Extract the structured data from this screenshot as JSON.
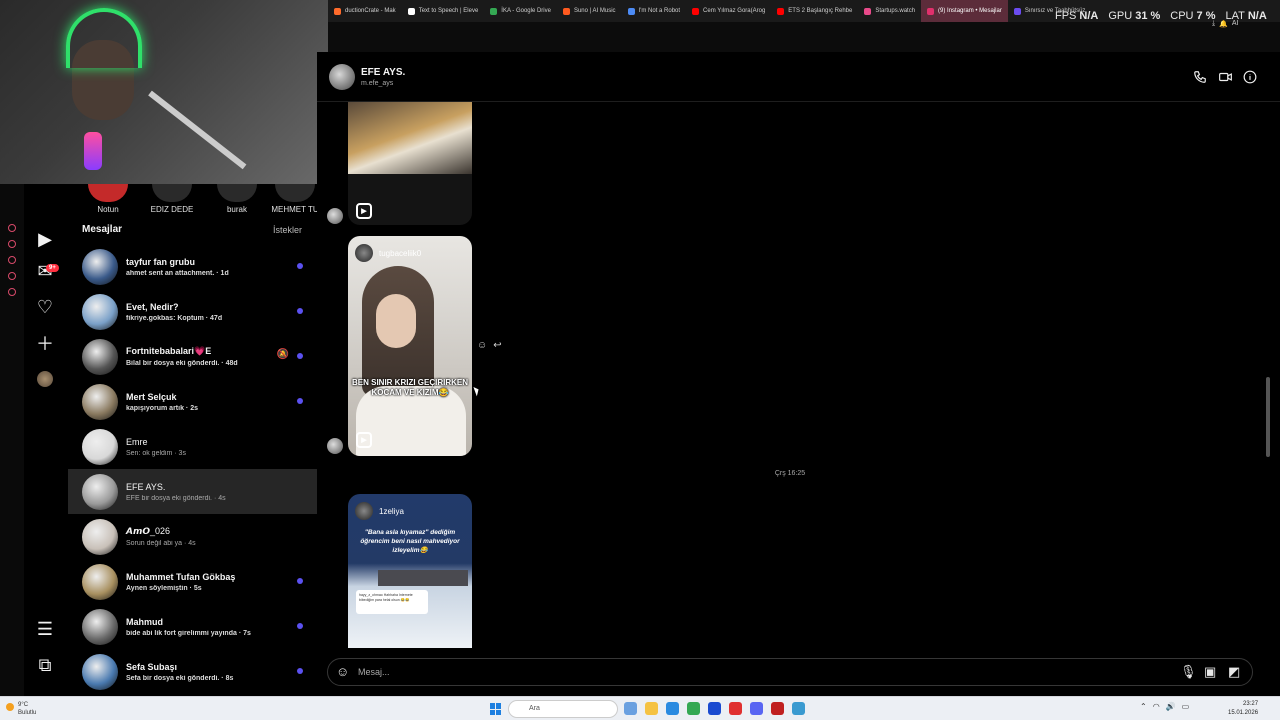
{
  "browser": {
    "tabs": [
      {
        "label": "ductionCrate - Mak",
        "color": "#ff6b2b"
      },
      {
        "label": "Text to Speech | Eleve",
        "color": "#ffffff"
      },
      {
        "label": "İKA - Google Drive",
        "color": "#34a853"
      },
      {
        "label": "Suno | AI Music",
        "color": "#ff5a1f"
      },
      {
        "label": "I'm Not a Robot",
        "color": "#4c8bf5"
      },
      {
        "label": "Cem Yılmaz Gora(Arog",
        "color": "#ff0000"
      },
      {
        "label": "ETS 2 Başlangıç Rehbe",
        "color": "#ff0000"
      },
      {
        "label": "Startups.watch",
        "color": "#e84a8a"
      },
      {
        "label": "(9) Instagram • Mesajlar",
        "color": "#e1306c"
      },
      {
        "label": "Sınırsız ve Taahhütsüz",
        "color": "#6b4cf0"
      }
    ]
  },
  "overlay": {
    "fps_label": "FPS",
    "fps_value": "N/A",
    "gpu_label": "GPU",
    "gpu_value": "31 %",
    "cpu_label": "CPU",
    "cpu_value": "7 %",
    "lat_label": "LAT",
    "lat_value": "N/A",
    "ai_label": "AI"
  },
  "notes": [
    {
      "label": "Notun"
    },
    {
      "label": "EDIZ DEDE"
    },
    {
      "label": "burak"
    },
    {
      "label": "MEHMET TU"
    }
  ],
  "sidebar": {
    "badge": "9+"
  },
  "conversations": {
    "header": "Mesajlar",
    "requests": "İstekler",
    "items": [
      {
        "name": "tayfur fan grubu",
        "preview": "ahmet sent an attachment.",
        "time": "1d",
        "unread": true,
        "avatar": "#3a5a8a"
      },
      {
        "name": "Evet, Nedir?",
        "preview": "fikriye.gokbas: Koptum",
        "time": "47d",
        "unread": true,
        "avatar": "#7aa0c8"
      },
      {
        "name": "Fortnitebabalari💗E",
        "preview": "Bilal bir dosya eki gönderdi.",
        "time": "48d",
        "unread": true,
        "muted": true,
        "avatar": "#555555"
      },
      {
        "name": "Mert Selçuk",
        "preview": "kapışıyorum artık",
        "time": "2s",
        "unread": true,
        "avatar": "#8a7a60"
      },
      {
        "name": "Emre",
        "preview": "Sen: ok geldim",
        "time": "3s",
        "unread": false,
        "avatar": "#d8d8d8"
      },
      {
        "name": "EFE AYS.",
        "preview": "EFE bir dosya eki gönderdi.",
        "time": "4s",
        "unread": false,
        "selected": true,
        "avatar": "#9a9a9a"
      },
      {
        "name": "𝘼𝙢𝙊_026",
        "preview": "Sorun değil abi ya",
        "time": "4s",
        "unread": false,
        "avatar": "#c8c0b8"
      },
      {
        "name": "Muhammet Tufan Gökbaş",
        "preview": "Aynen söylemiştin",
        "time": "5s",
        "unread": true,
        "avatar": "#a89060"
      },
      {
        "name": "Mahmud",
        "preview": "bide abi lik fort girelimmi yayında",
        "time": "7s",
        "unread": true,
        "avatar": "#6a6a6a"
      },
      {
        "name": "Sefa Subaşı",
        "preview": "Sefa bir dosya eki gönderdi.",
        "time": "8s",
        "unread": true,
        "avatar": "#4a7ab0"
      }
    ]
  },
  "chat": {
    "name": "EFE AYS.",
    "username": "m.efe_ays",
    "reel2_user": "tugbaceliik0",
    "reel2_caption": "BEN SINIR KRIZI GEÇIRIRKEN KOCAM VE KIZIM😂",
    "timestamp": "Çrş 16:25",
    "reel3_user": "1zeliya",
    "reel3_quote": "\"Bana asla kıyamaz\" dediğim öğrencim beni nasıl mahvediyor izleyelim😂",
    "reel3_card": "hayy_z_ohmao Hahhaha Internete bibediğim para helal olsun 😂😂",
    "composer_placeholder": "Mesaj..."
  },
  "taskbar": {
    "temp": "9°C",
    "condition": "Bulutlu",
    "search": "Ara",
    "time": "23:27",
    "date": "15.01.2026"
  }
}
